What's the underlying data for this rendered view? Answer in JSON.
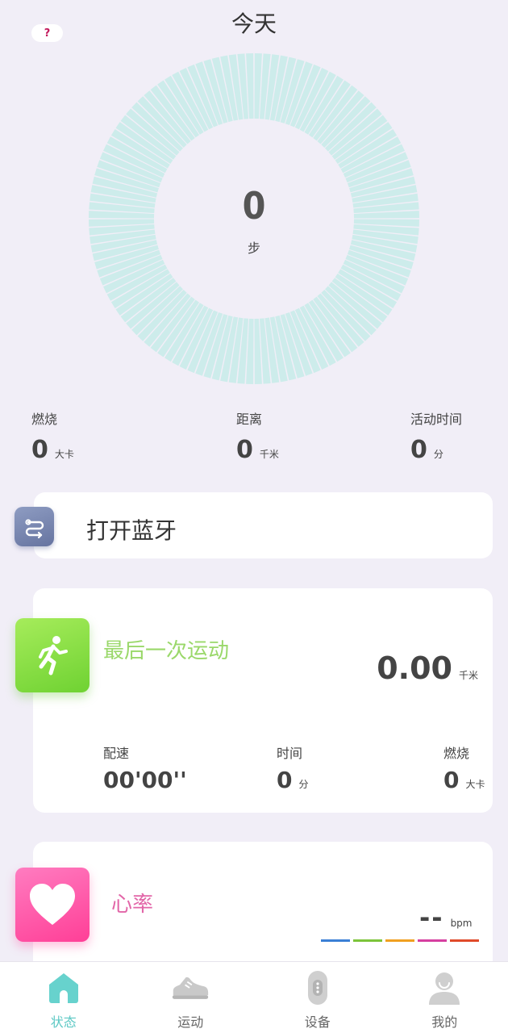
{
  "header": {
    "title": "今天",
    "help_label": "?"
  },
  "steps": {
    "value": "0",
    "unit": "步",
    "progress": 0
  },
  "stats": [
    {
      "label": "燃烧",
      "value": "0",
      "unit": "大卡"
    },
    {
      "label": "距离",
      "value": "0",
      "unit": "千米"
    },
    {
      "label": "活动时间",
      "value": "0",
      "unit": "分"
    }
  ],
  "bluetooth": {
    "label": "打开蓝牙"
  },
  "last_sport": {
    "title": "最后一次运动",
    "distance": "0.00",
    "distance_unit": "千米",
    "stats": [
      {
        "label": "配速",
        "value": "00'00''",
        "unit": ""
      },
      {
        "label": "时间",
        "value": "0",
        "unit": "分"
      },
      {
        "label": "燃烧",
        "value": "0",
        "unit": "大卡"
      }
    ]
  },
  "heart_rate": {
    "title": "心率",
    "value": "--",
    "unit": "bpm",
    "zone_colors": [
      "#3a7fd5",
      "#7cc43a",
      "#f0a020",
      "#d63fa0",
      "#e04a2a"
    ]
  },
  "tabs": [
    {
      "label": "状态",
      "icon": "home-icon",
      "active": true
    },
    {
      "label": "运动",
      "icon": "shoe-icon",
      "active": false
    },
    {
      "label": "设备",
      "icon": "band-icon",
      "active": false
    },
    {
      "label": "我的",
      "icon": "user-icon",
      "active": false
    }
  ],
  "colors": {
    "background": "#f1eef7",
    "ring": "#cdeceb",
    "accent": "#5cc8c4",
    "sport": "#9ad86a",
    "heart": "#e266a8"
  }
}
